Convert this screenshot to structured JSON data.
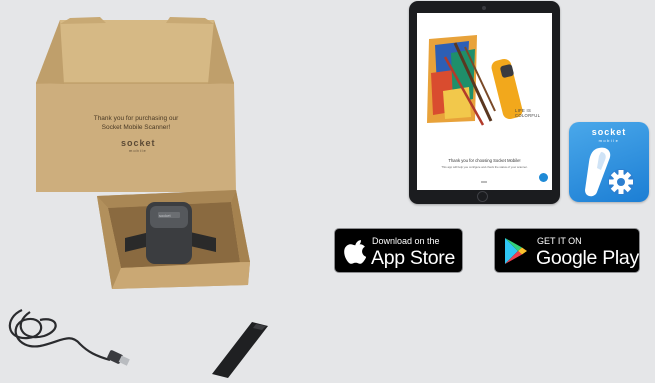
{
  "package": {
    "thank_you_line1": "Thank you for purchasing our",
    "thank_you_line2": "Socket Mobile Scanner!",
    "brand_name": "socket",
    "brand_sub": "mobile"
  },
  "tablet": {
    "tagline_line1": "LIFE IS",
    "tagline_line2": "COLORFUL",
    "caption": "Thank you for choosing Socket Mobile!",
    "subcaption": "This app will help you configure and check the status of your scanner."
  },
  "app_icon": {
    "brand_name": "socket",
    "brand_sub": "mobile",
    "icon": "scanner-gear-icon"
  },
  "app_store": {
    "small": "Download on the",
    "big": "App Store",
    "icon": "apple-icon"
  },
  "google_play": {
    "small": "GET IT ON",
    "big": "Google Play",
    "icon": "play-triangle-icon"
  },
  "colors": {
    "background": "#e5e6e8",
    "cardboard": "#c9a978",
    "app_icon_blue": "#2b8fdf",
    "badge_black": "#000000"
  }
}
